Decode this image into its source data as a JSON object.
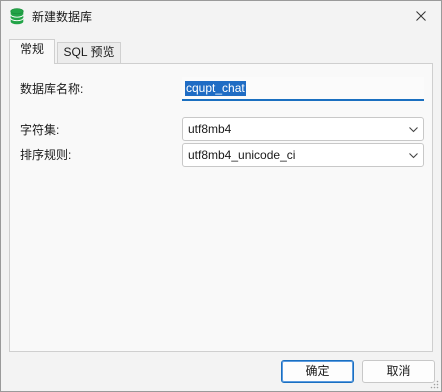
{
  "window": {
    "title": "新建数据库",
    "icon": "database-icon",
    "close_icon": "close-icon"
  },
  "tabs": [
    {
      "label": "常规",
      "active": true
    },
    {
      "label": "SQL 预览",
      "active": false
    }
  ],
  "form": {
    "db_name_label": "数据库名称:",
    "db_name_value": "cqupt_chat",
    "charset_label": "字符集:",
    "charset_value": "utf8mb4",
    "collation_label": "排序规则:",
    "collation_value": "utf8mb4_unicode_ci"
  },
  "buttons": {
    "ok_label": "确定",
    "cancel_label": "取消"
  },
  "colors": {
    "accent": "#1a6fc0",
    "selection": "#1f6cc4",
    "db_icon": "#22a447"
  }
}
